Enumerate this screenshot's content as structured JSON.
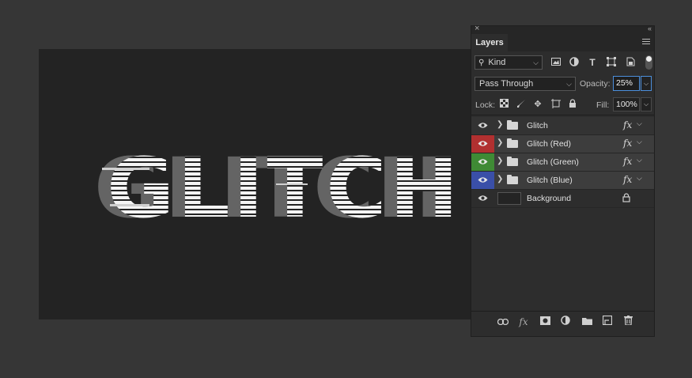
{
  "canvas": {
    "artwork_text": "GLITCH",
    "text_color": "#f4f4f4",
    "background_color": "#232323"
  },
  "panel": {
    "title": "Layers",
    "filter": {
      "label": "Kind"
    },
    "blend_mode": "Pass Through",
    "opacity_label": "Opacity:",
    "opacity_value": "25%",
    "lock_label": "Lock:",
    "fill_label": "Fill:",
    "fill_value": "100%"
  },
  "layers": [
    {
      "name": "Glitch",
      "type": "group",
      "has_fx": true,
      "visible": true,
      "eye_color": ""
    },
    {
      "name": "Glitch (Red)",
      "type": "group",
      "has_fx": true,
      "visible": true,
      "eye_color": "#b13030"
    },
    {
      "name": "Glitch (Green)",
      "type": "group",
      "has_fx": true,
      "visible": true,
      "eye_color": "#3f8a35"
    },
    {
      "name": "Glitch (Blue)",
      "type": "group",
      "has_fx": true,
      "visible": true,
      "eye_color": "#3a4fa8"
    },
    {
      "name": "Background",
      "type": "pixel",
      "has_fx": false,
      "visible": true,
      "locked": true,
      "eye_color": ""
    }
  ],
  "icons": {
    "filter_row": [
      "image-filter-icon",
      "adjustment-filter-icon",
      "type-filter-icon",
      "shape-filter-icon",
      "smart-object-filter-icon"
    ],
    "lock_row": [
      "lock-transparent-icon",
      "lock-image-icon",
      "lock-position-icon",
      "lock-artboard-icon",
      "lock-all-icon"
    ],
    "bottom_bar": [
      "link-icon",
      "fx-icon",
      "mask-icon",
      "adjustment-icon",
      "folder-icon",
      "new-layer-icon",
      "trash-icon"
    ]
  },
  "fx_symbol": "fx",
  "accent_color": "#4c8fdc"
}
